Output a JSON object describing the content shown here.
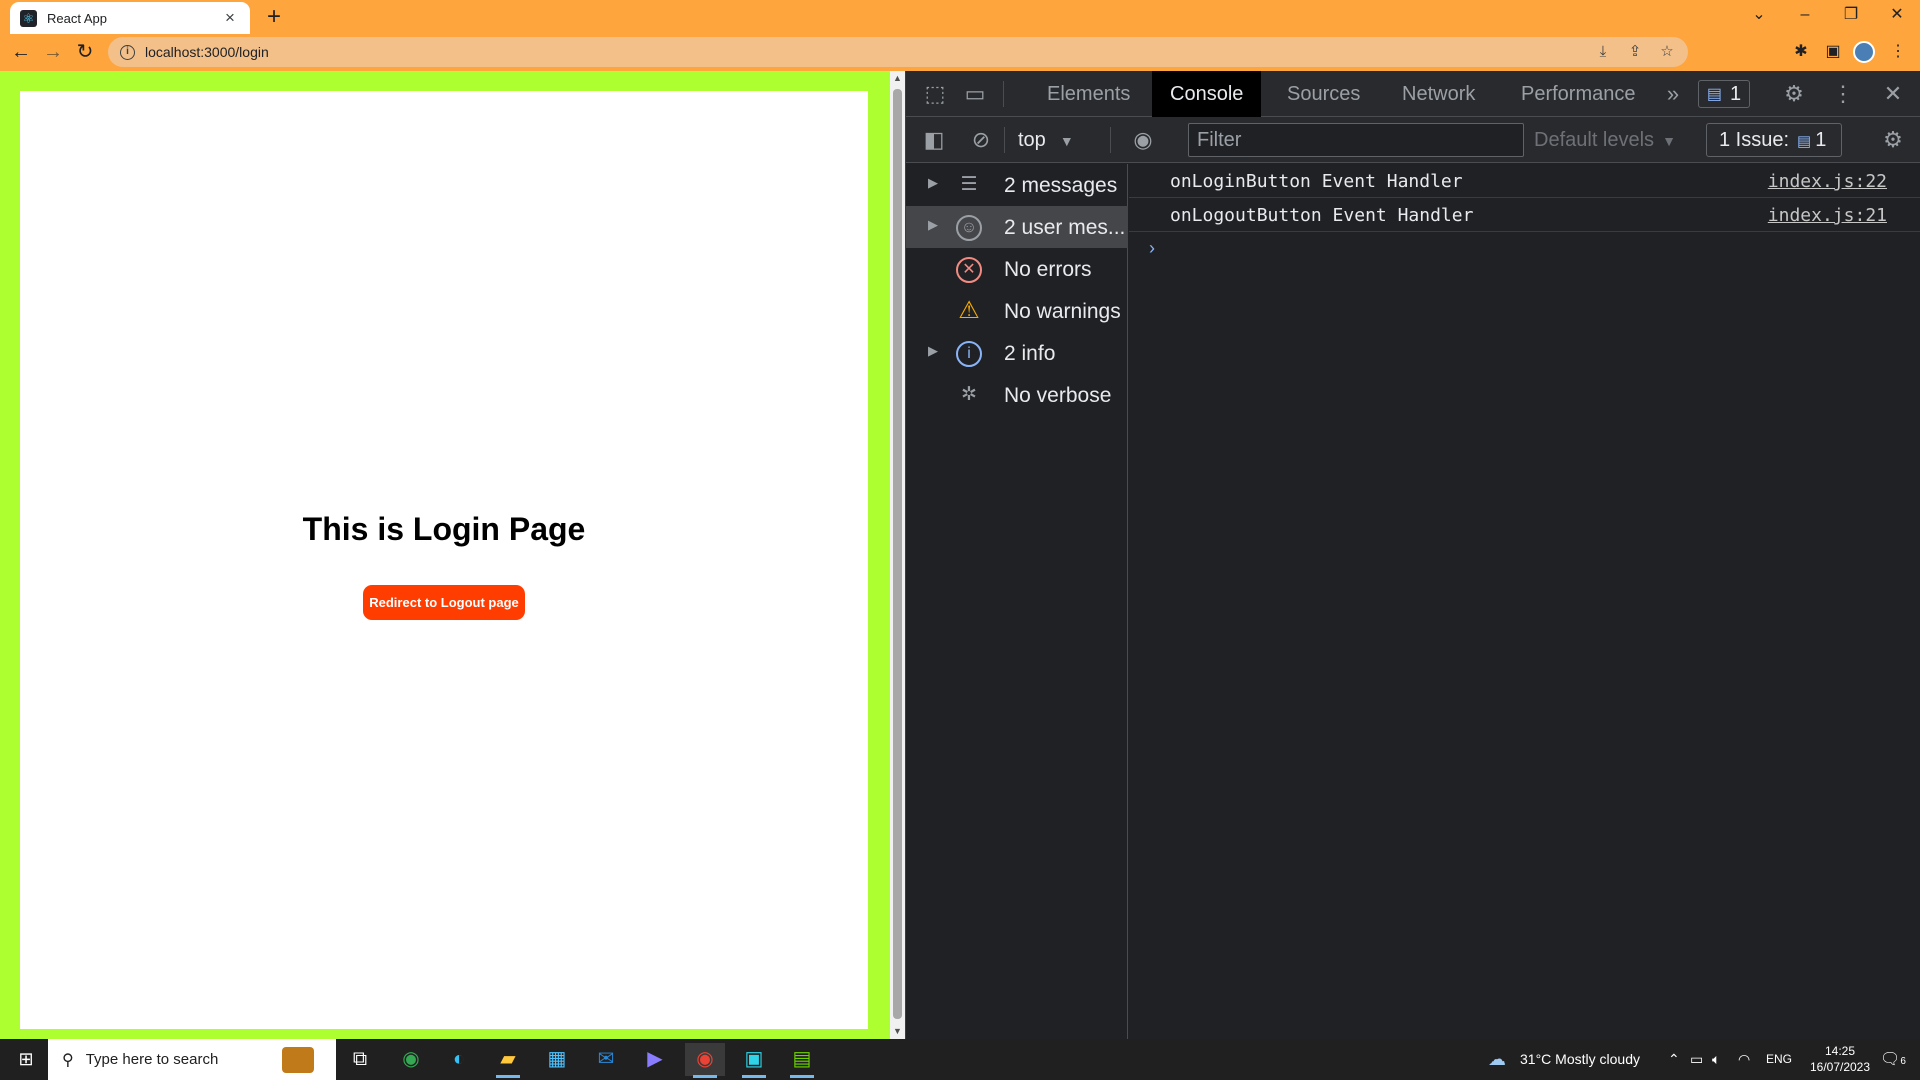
{
  "browser": {
    "tab_title": "React App",
    "tab_favicon_icon": "react-icon",
    "url": "localhost:3000/login",
    "title_bar_color": "#ffa53d"
  },
  "page": {
    "heading": "This is Login Page",
    "button_label": "Redirect to Logout page",
    "background_color": "#adff2f",
    "button_color": "#ff3d00"
  },
  "devtools": {
    "tabs": [
      {
        "label": "Elements"
      },
      {
        "label": "Console"
      },
      {
        "label": "Sources"
      },
      {
        "label": "Network"
      },
      {
        "label": "Performance"
      }
    ],
    "active_tab": "Console",
    "issue_count": "1",
    "context": "top",
    "filter_placeholder": "Filter",
    "levels_label": "Default levels",
    "issues_label": "1 Issue:",
    "issues_count": "1",
    "sidebar": [
      {
        "label": "2 messages",
        "icon": "list-icon",
        "expandable": true
      },
      {
        "label": "2 user mes...",
        "icon": "user-icon",
        "expandable": true,
        "selected": true
      },
      {
        "label": "No errors",
        "icon": "error-icon",
        "expandable": false
      },
      {
        "label": "No warnings",
        "icon": "warning-icon",
        "expandable": false
      },
      {
        "label": "2 info",
        "icon": "info-icon",
        "expandable": true
      },
      {
        "label": "No verbose",
        "icon": "bug-icon",
        "expandable": false
      }
    ],
    "messages": [
      {
        "text": "onLoginButton Event Handler",
        "source": "index.js:22"
      },
      {
        "text": "onLogoutButton Event Handler",
        "source": "index.js:21"
      }
    ]
  },
  "taskbar": {
    "search_placeholder": "Type here to search",
    "weather": "31°C  Mostly cloudy",
    "language": "ENG",
    "time": "14:25",
    "date": "16/07/2023",
    "notifications": "6"
  }
}
